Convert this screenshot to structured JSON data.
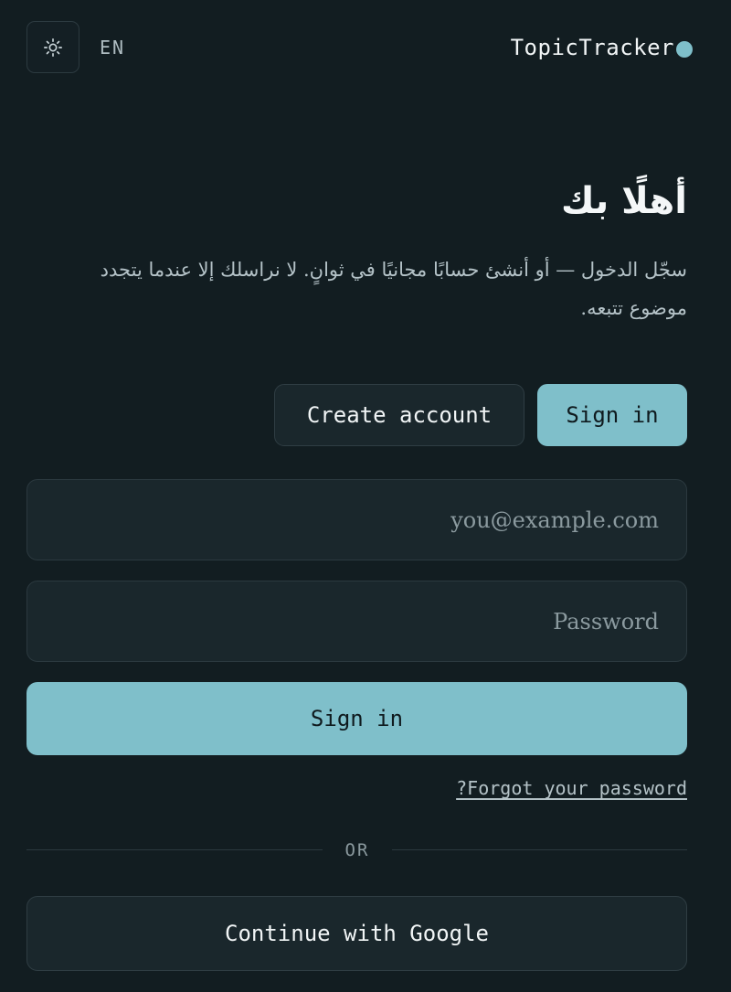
{
  "header": {
    "theme_icon": "sun-icon",
    "language": "EN",
    "brand": "TopicTracker"
  },
  "hero": {
    "title": "أهلًا بك",
    "subtitle": "سجّل الدخول — أو أنشئ حسابًا مجانيًا في ثوانٍ. لا نراسلك إلا عندما يتجدد موضوع تتبعه."
  },
  "tabs": {
    "create_account": "Create account",
    "sign_in": "Sign in"
  },
  "form": {
    "email_placeholder": "you@example.com",
    "password_placeholder": "Password",
    "submit_label": "Sign in",
    "forgot_label": "?Forgot your password"
  },
  "divider": {
    "label": "OR"
  },
  "oauth": {
    "google_label": "Continue with Google"
  },
  "colors": {
    "background": "#121d21",
    "surface": "#1a272c",
    "accent": "#7fbfca",
    "text": "#f1f5f6",
    "muted": "#8b9a9f"
  }
}
